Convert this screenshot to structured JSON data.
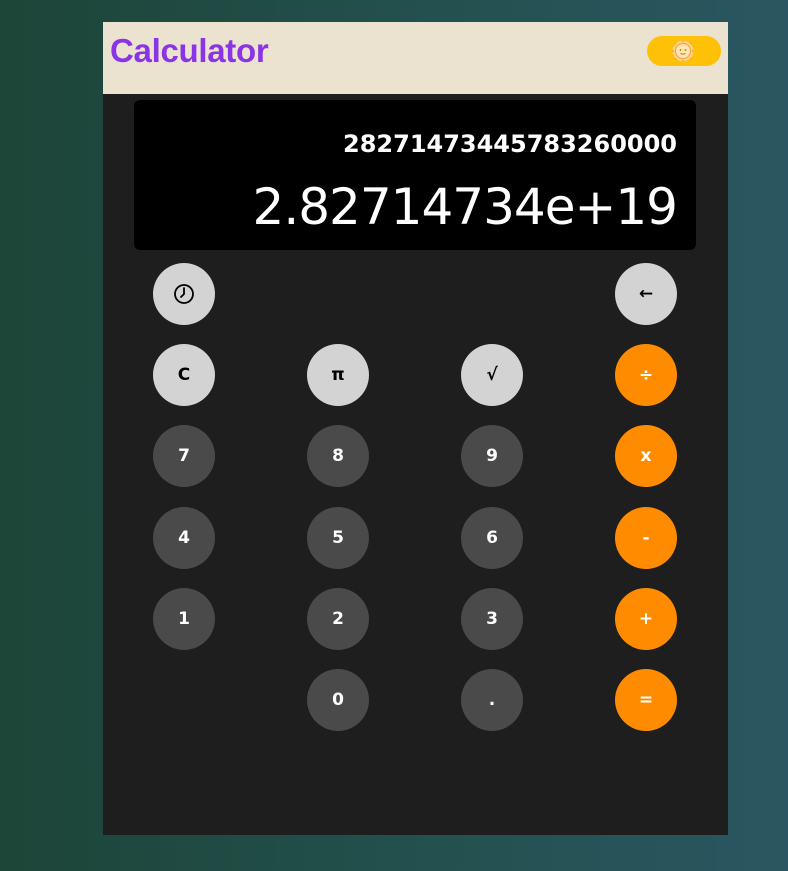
{
  "header": {
    "title": "Calculator",
    "theme_toggle_icon": "sun-icon"
  },
  "display": {
    "expression": "28271473445783260000",
    "result": "2.82714734e+19"
  },
  "buttons": {
    "history_icon": "history-clock-icon",
    "backspace": "←",
    "clear": "C",
    "pi": "π",
    "sqrt": "√",
    "divide": "÷",
    "seven": "7",
    "eight": "8",
    "nine": "9",
    "multiply": "x",
    "four": "4",
    "five": "5",
    "six": "6",
    "subtract": "-",
    "one": "1",
    "two": "2",
    "three": "3",
    "add": "+",
    "zero": "0",
    "decimal": ".",
    "equals": "="
  },
  "colors": {
    "title": "#8a34e6",
    "header_bg": "#ebe3d0",
    "toggle": "#ffc107",
    "operator": "#ff8c00",
    "function": "#d3d3d3",
    "digit": "#4a4a4a",
    "body_bg": "#1e1e1e"
  }
}
